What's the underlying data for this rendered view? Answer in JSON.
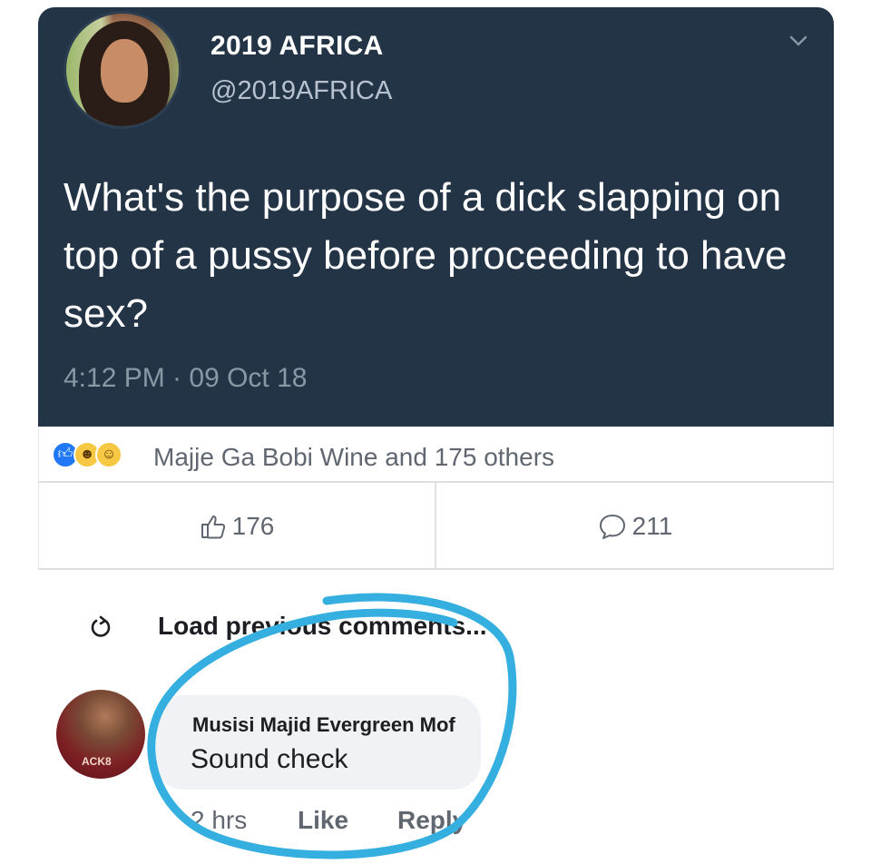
{
  "tweet": {
    "display_name": "2019 AFRICA",
    "handle": "@2019AFRICA",
    "text": "What's the purpose of a dick slapping on top of a pussy before proceeding to have sex?",
    "timestamp": "4:12 PM · 09 Oct 18",
    "menu_icon": "chevron-down-icon",
    "colors": {
      "background": "#243447",
      "text": "#ffffff",
      "muted": "#8899a6"
    }
  },
  "reactions": {
    "icons": [
      "like-reaction-icon",
      "haha-reaction-icon",
      "wow-reaction-icon"
    ],
    "summary": "Majje Ga Bobi Wine and 175 others"
  },
  "actions": {
    "like_count": "176",
    "comment_count": "211"
  },
  "comments_section": {
    "load_previous": "Load previous comments..."
  },
  "comment": {
    "author": "Musisi Majid Evergreen Mof",
    "body": "Sound check",
    "time": "2 hrs",
    "like_label": "Like",
    "reply_label": "Reply",
    "avatar_caption": "ACK8"
  },
  "annotation": {
    "color": "#35aee0"
  }
}
